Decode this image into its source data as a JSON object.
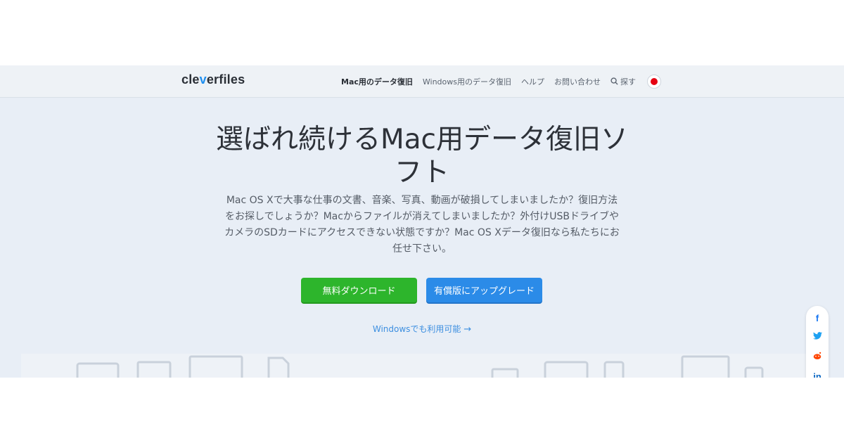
{
  "logo": {
    "text_pre": "cle",
    "text_mark": "v",
    "text_post": "erfiles"
  },
  "nav": {
    "items": [
      {
        "label": "Mac用のデータ復旧",
        "active": true
      },
      {
        "label": "Windows用のデータ復旧",
        "active": false
      },
      {
        "label": "ヘルプ",
        "active": false
      },
      {
        "label": "お問い合わせ",
        "active": false
      },
      {
        "label": "探す",
        "active": false
      }
    ],
    "language_flag": "japan-flag-icon"
  },
  "hero": {
    "title": "選ばれ続けるMac用データ復旧ソフト",
    "description": "Mac OS Xで大事な仕事の文書、音楽、写真、動画が破損してしまいましたか？復旧方法をお探しでしょうか？Macからファイルが消えてしまいましたか？外付けUSBドライブやカメラのSDカードにアクセスできない状態ですか？Mac OS Xデータ復旧なら私たちにお任せ下さい。",
    "download_label": "無料ダウンロード",
    "upgrade_label": "有償版にアップグレード",
    "windows_link": "Windowsでも利用可能"
  },
  "social": [
    "facebook-icon",
    "twitter-icon",
    "reddit-icon",
    "linkedin-icon"
  ],
  "colors": {
    "accent_green": "#2db52c",
    "accent_blue": "#2b8be8",
    "link_blue": "#3d8fe0",
    "background": "#e8eef6"
  }
}
